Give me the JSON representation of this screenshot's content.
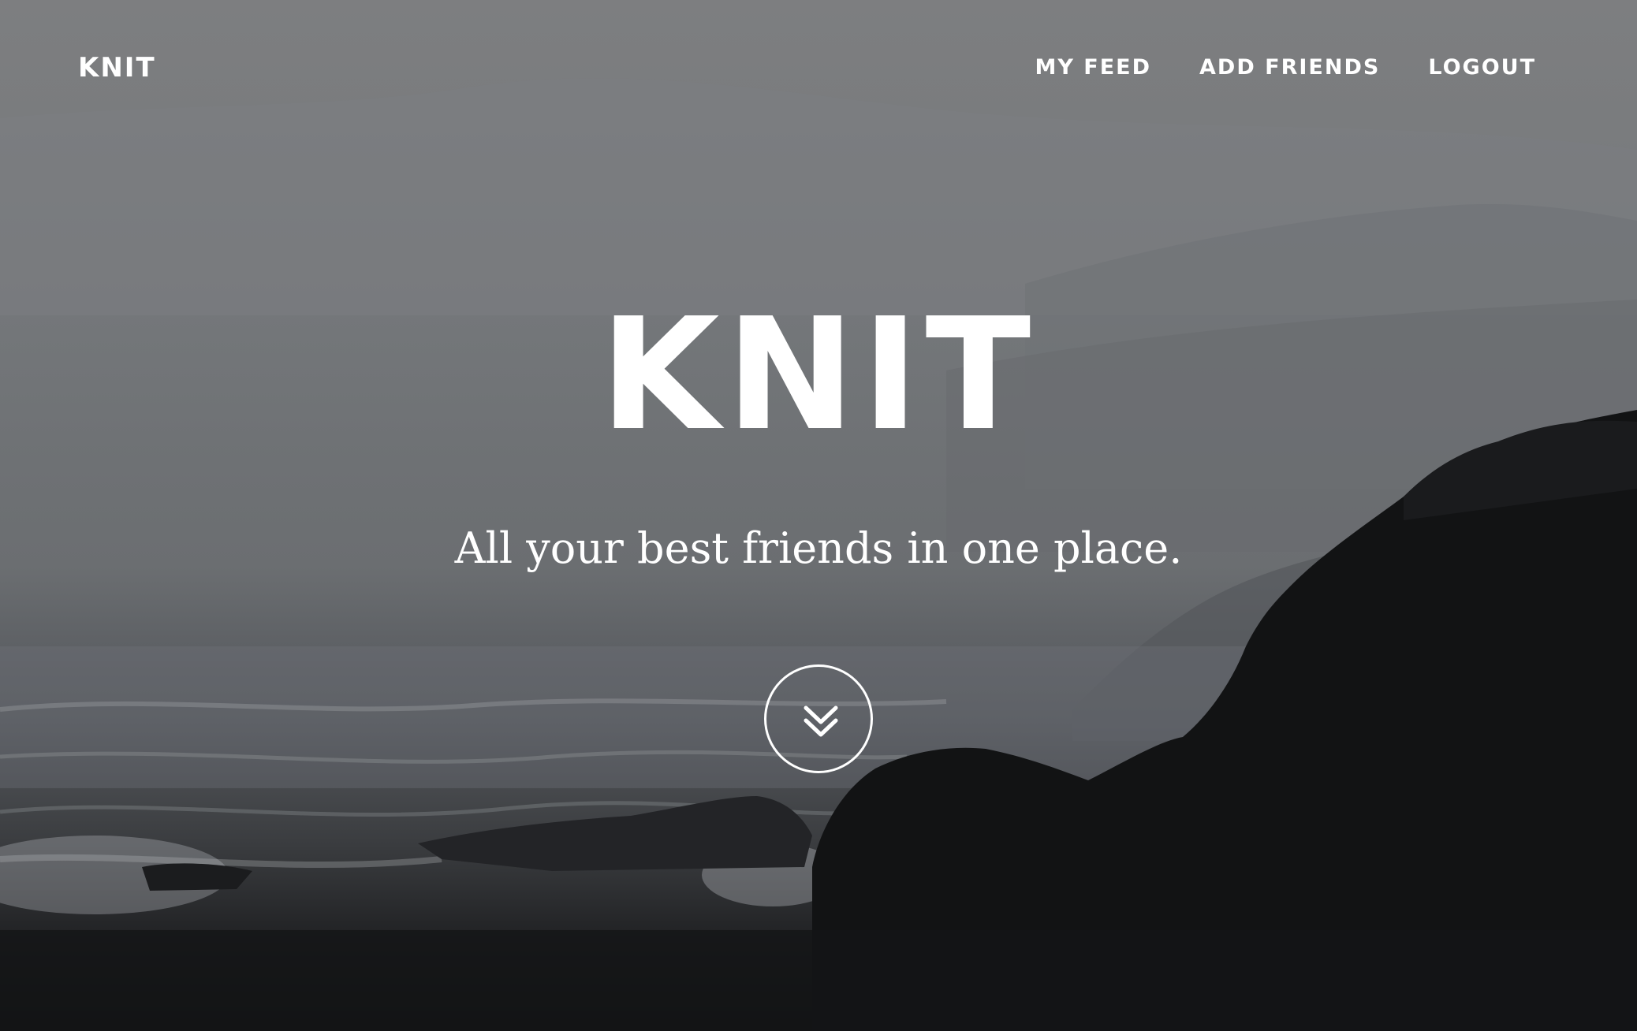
{
  "nav": {
    "brand": "KNIT",
    "links": [
      {
        "label": "MY FEED"
      },
      {
        "label": "ADD FRIENDS"
      },
      {
        "label": "LOGOUT"
      }
    ]
  },
  "hero": {
    "title": "KNIT",
    "subtitle": "All your best friends in one place.",
    "scroll_icon": "double-chevron-down-icon"
  },
  "colors": {
    "text": "#ffffff",
    "overlay_top": "#7d7e80",
    "overlay_bottom": "#0f1011"
  }
}
